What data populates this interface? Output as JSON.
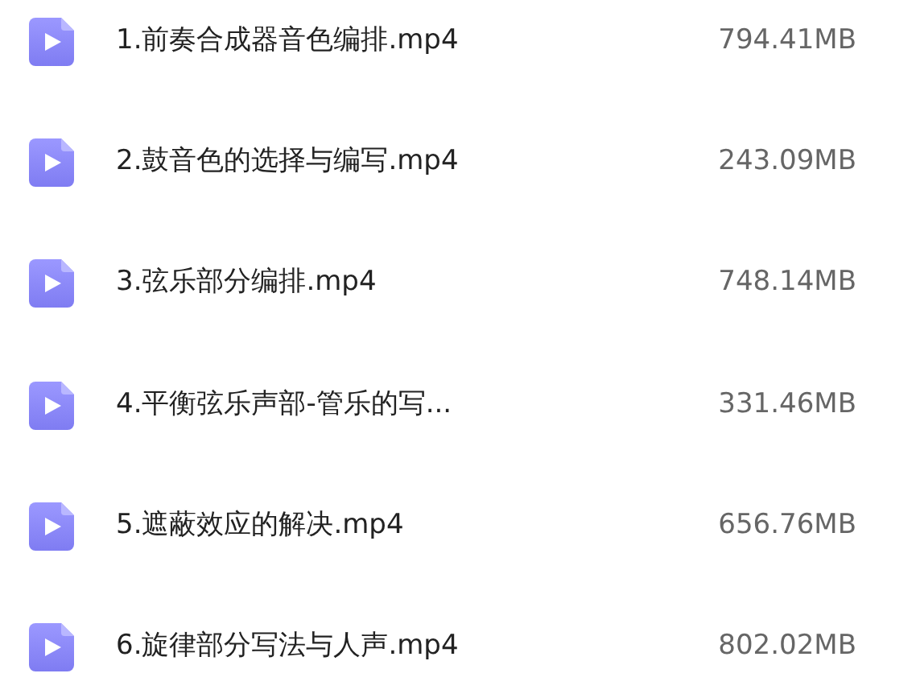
{
  "files": [
    {
      "name": "1.前奏合成器音色编排.mp4",
      "size": "794.41MB"
    },
    {
      "name": "2.鼓音色的选择与编写.mp4",
      "size": "243.09MB"
    },
    {
      "name": "3.弦乐部分编排.mp4",
      "size": "748.14MB"
    },
    {
      "name": "4.平衡弦乐声部-管乐的写...",
      "size": "331.46MB"
    },
    {
      "name": "5.遮蔽效应的解决.mp4",
      "size": "656.76MB"
    },
    {
      "name": "6.旋律部分写法与人声.mp4",
      "size": "802.02MB"
    }
  ]
}
